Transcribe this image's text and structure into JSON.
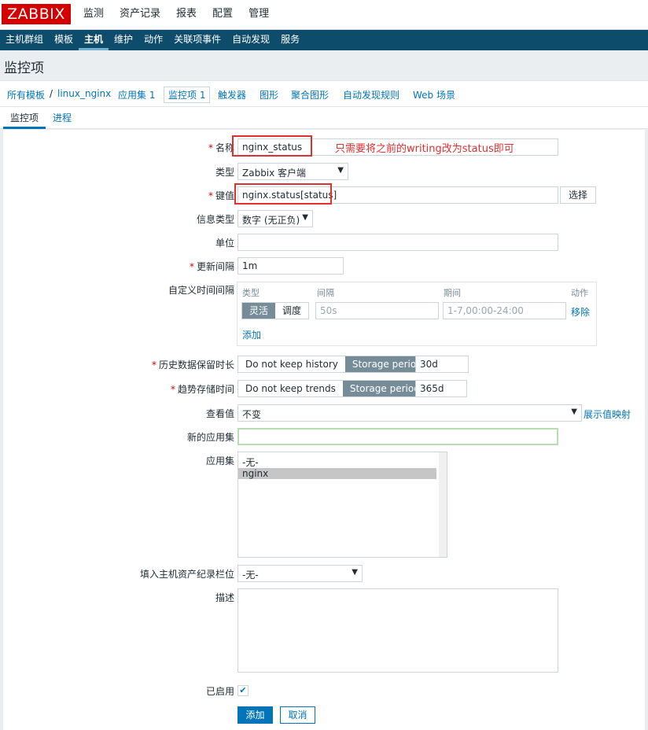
{
  "logo": "ZABBIX",
  "top_menu": [
    "监测",
    "资产记录",
    "报表",
    "配置",
    "管理"
  ],
  "sub_nav": [
    "主机群组",
    "模板",
    "主机",
    "维护",
    "动作",
    "关联项事件",
    "自动发现",
    "服务"
  ],
  "page_title": "监控项",
  "breadcrumb": {
    "all_templates": "所有模板",
    "sep": "/",
    "host": "linux_nginx",
    "applications": "应用集 1",
    "items": "监控项 1",
    "triggers": "触发器",
    "graphs": "图形",
    "screens": "聚合图形",
    "discovery": "自动发现规则",
    "web": "Web 场景"
  },
  "tabs": [
    "监控项",
    "进程"
  ],
  "form": {
    "name_label": "名称",
    "name_value": "nginx_status",
    "annotation": "只需要将之前的writing改为status即可",
    "type_label": "类型",
    "type_value": "Zabbix 客户端",
    "key_label": "键值",
    "key_value": "nginx.status[status]",
    "select_button": "选择",
    "info_type_label": "信息类型",
    "info_type_value": "数字 (无正负)",
    "units_label": "单位",
    "units_value": "",
    "interval_label": "更新间隔",
    "interval_value": "1m",
    "custom_intervals_label": "自定义时间间隔",
    "ci_col_type": "类型",
    "ci_col_interval": "间隔",
    "ci_col_period": "期间",
    "ci_col_action": "动作",
    "ci_flexible": "灵活",
    "ci_scheduling": "调度",
    "ci_interval_placeholder": "50s",
    "ci_period_placeholder": "1-7,00:00-24:00",
    "ci_remove": "移除",
    "ci_add": "添加",
    "history_label": "历史数据保留时长",
    "history_no_keep": "Do not keep history",
    "history_storage": "Storage period",
    "history_value": "30d",
    "trends_label": "趋势存储时间",
    "trends_no_keep": "Do not keep trends",
    "trends_storage": "Storage period",
    "trends_value": "365d",
    "show_value_label": "查看值",
    "show_value_value": "不变",
    "value_mapping_link": "展示值映射",
    "new_app_label": "新的应用集",
    "new_app_value": "",
    "apps_label": "应用集",
    "apps_options": [
      "-无-",
      "nginx"
    ],
    "inventory_label": "填入主机资产纪录栏位",
    "inventory_value": "-无-",
    "description_label": "描述",
    "description_value": "",
    "enabled_label": "已启用",
    "add_button": "添加",
    "cancel_button": "取消"
  },
  "colors": {
    "brand_red": "#d40000",
    "nav_blue": "#0e4c6b",
    "link_blue": "#0275b8",
    "annotation_red": "#e03030"
  }
}
